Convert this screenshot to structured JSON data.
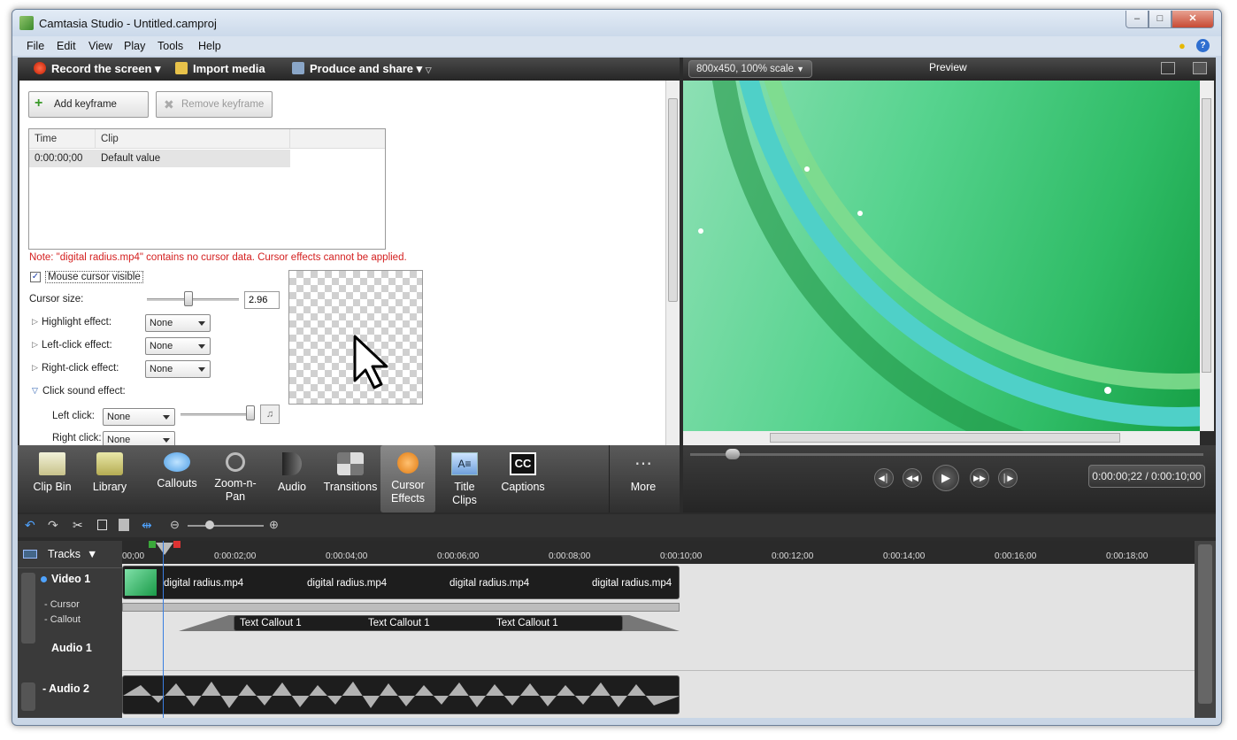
{
  "window": {
    "title": "Camtasia Studio - Untitled.camproj"
  },
  "menu": [
    "File",
    "Edit",
    "View",
    "Play",
    "Tools",
    "Help"
  ],
  "toolbar": {
    "record": "Record the screen",
    "import": "Import media",
    "produce": "Produce and share"
  },
  "cursor_effects": {
    "add_keyframe": "Add keyframe",
    "remove_keyframe": "Remove keyframe",
    "table_headers": [
      "Time",
      "Clip"
    ],
    "table_row": {
      "time": "0:00:00;00",
      "clip": "Default value"
    },
    "note": "Note: \"digital radius.mp4\" contains no cursor data. Cursor effects cannot be applied.",
    "mouse_cursor_visible": "Mouse cursor visible",
    "cursor_size_label": "Cursor size:",
    "cursor_size_value": "2.96",
    "cursor_size_fraction": 0.45,
    "highlight_label": "Highlight effect:",
    "left_click_label": "Left-click effect:",
    "right_click_label": "Right-click effect:",
    "click_sound_label": "Click sound effect:",
    "left_click_sound_label": "Left click:",
    "right_click_sound_label": "Right click:",
    "none": "None"
  },
  "tool_tabs": [
    {
      "name": "tab-clip-bin",
      "label": "Clip Bin"
    },
    {
      "name": "tab-library",
      "label": "Library"
    },
    {
      "name": "tab-callouts",
      "label": "Callouts"
    },
    {
      "name": "tab-zoom-n-pan",
      "label": "Zoom-n-Pan"
    },
    {
      "name": "tab-audio",
      "label": "Audio"
    },
    {
      "name": "tab-transitions",
      "label": "Transitions"
    },
    {
      "name": "tab-cursor-effects",
      "label": "Cursor Effects"
    },
    {
      "name": "tab-title-clips",
      "label": "Title Clips"
    },
    {
      "name": "tab-captions",
      "label": "Captions"
    },
    {
      "name": "tab-more",
      "label": "More"
    }
  ],
  "preview": {
    "scale": "800x450, 100% scale",
    "title": "Preview",
    "time": "0:00:00;22 / 0:00:10;00"
  },
  "timeline": {
    "tracks_label": "Tracks",
    "ticks": [
      "00;00",
      "0:00:02;00",
      "0:00:04;00",
      "0:00:06;00",
      "0:00:08;00",
      "0:00:10;00",
      "0:00:12;00",
      "0:00:14;00",
      "0:00:16;00",
      "0:00:18;00"
    ],
    "video_track": "Video 1",
    "cursor_track": "Cursor",
    "callout_track": "Callout",
    "audio1_track": "Audio 1",
    "audio2_track": "Audio 2",
    "video_clip_label": "digital radius.mp4",
    "callout_label": "Text Callout 1"
  }
}
